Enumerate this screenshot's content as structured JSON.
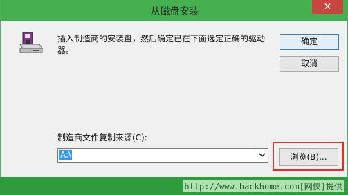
{
  "window": {
    "title": "从磁盘安装",
    "close_glyph": "✕"
  },
  "dialog": {
    "icon": "disk-drive-icon",
    "message": "插入制造商的安装盘，然后确定已在下面选定正确的驱动器。",
    "ok_label": "确定",
    "cancel_label": "取消",
    "source_label": "制造商文件复制来源(C):",
    "source_value": "A:\\",
    "browse_label": "浏览(B)..."
  },
  "watermark": {
    "text": "http://www.hackhome.com[网侠]提供"
  },
  "colors": {
    "titlebar": "#46b051",
    "close": "#c7463f",
    "highlight": "#e0322d",
    "selection": "#3399ff"
  }
}
